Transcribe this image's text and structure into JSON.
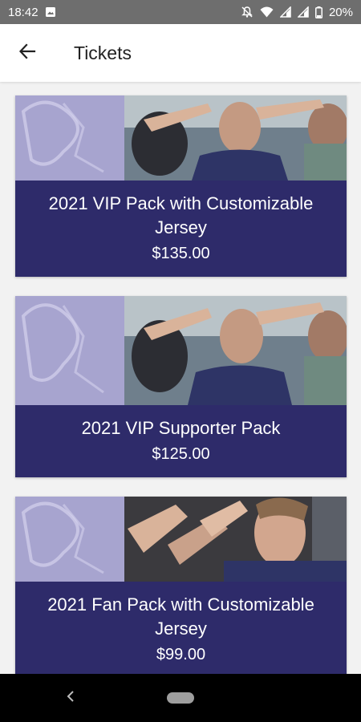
{
  "status_bar": {
    "time": "18:42",
    "battery": "20%",
    "icons": [
      "image-notification-icon",
      "notifications-off-icon",
      "wifi-icon",
      "signal-icon",
      "signal-icon",
      "battery-icon"
    ]
  },
  "app_bar": {
    "title": "Tickets",
    "back_icon": "arrow-left-icon"
  },
  "tickets": [
    {
      "name": "2021 VIP Pack with Customizable Jersey",
      "price": "$135.00"
    },
    {
      "name": "2021 VIP Supporter Pack",
      "price": "$125.00"
    },
    {
      "name": "2021 Fan Pack with Customizable Jersey",
      "price": "$99.00"
    }
  ],
  "colors": {
    "card_overlay": "#2e2b6a",
    "logo_panel": "#a7a4cf",
    "status_bar": "#6e6e6e",
    "background": "#f2f2f2"
  },
  "nav_bar": {
    "back_icon": "nav-back-chevron-icon",
    "home_icon": "home-pill-icon"
  }
}
